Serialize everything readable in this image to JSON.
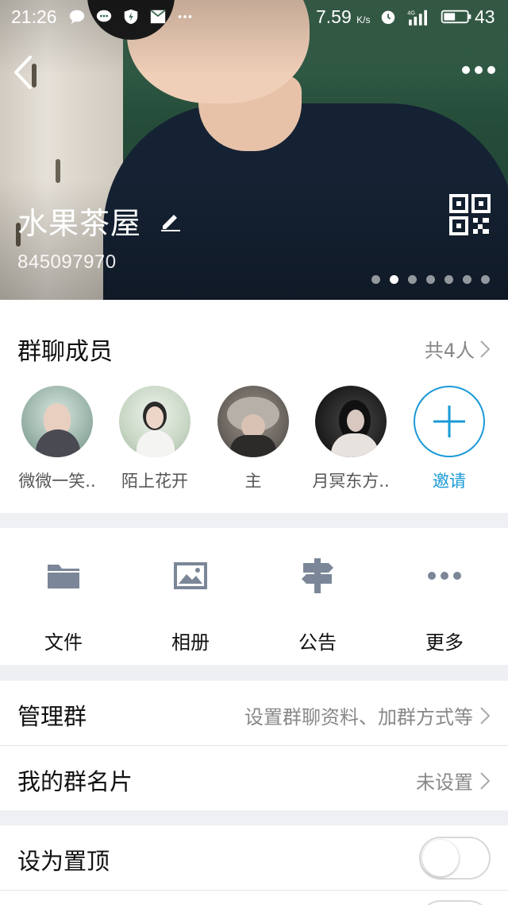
{
  "status_bar": {
    "time": "21:26",
    "net_speed": "7.59",
    "net_speed_unit": "K/s",
    "battery": "43"
  },
  "header": {
    "group_name": "水果茶屋",
    "group_id": "845097970",
    "page_count": 7,
    "active_page": 2
  },
  "members": {
    "title": "群聊成员",
    "count_label": "共4人",
    "list": [
      {
        "name": "微微一笑.."
      },
      {
        "name": "陌上花开"
      },
      {
        "name": "主"
      },
      {
        "name": "月冥东方.."
      }
    ],
    "invite_label": "邀请"
  },
  "tools": [
    {
      "label": "文件",
      "icon": "folder-icon"
    },
    {
      "label": "相册",
      "icon": "image-icon"
    },
    {
      "label": "公告",
      "icon": "signpost-icon"
    },
    {
      "label": "更多",
      "icon": "more-dots-icon"
    }
  ],
  "settings": {
    "manage": {
      "label": "管理群",
      "value": "设置群聊资料、加群方式等"
    },
    "card": {
      "label": "我的群名片",
      "value": "未设置"
    },
    "pin": {
      "label": "设为置顶",
      "enabled": false
    }
  },
  "colors": {
    "accent": "#1a9ad6",
    "icon_gray": "#7b8798"
  }
}
